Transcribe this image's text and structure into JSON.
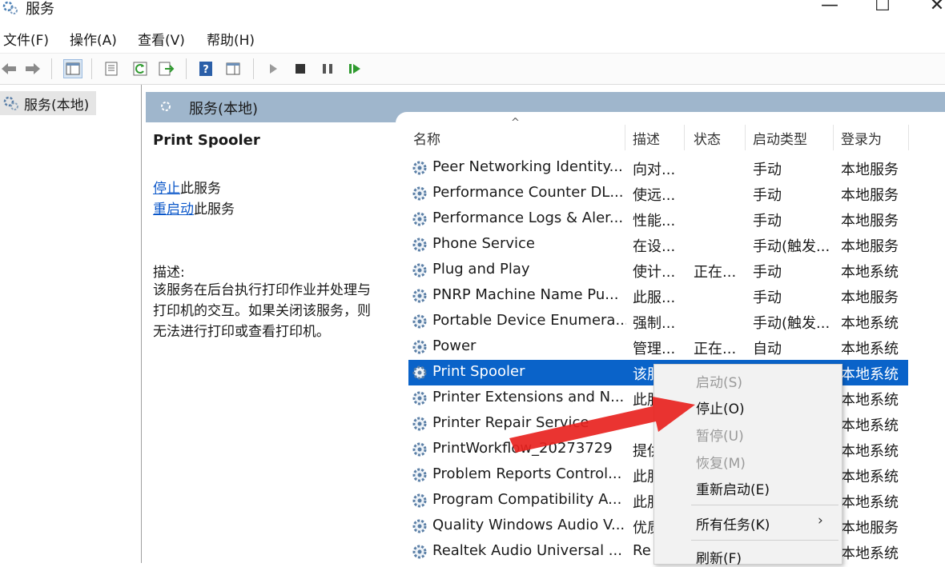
{
  "window": {
    "title": "服务",
    "controls": {
      "minimize": "—",
      "maximize": "☐",
      "close": "✕"
    }
  },
  "menu": [
    "文件(F)",
    "操作(A)",
    "查看(V)",
    "帮助(H)"
  ],
  "toolbar": {
    "icons": [
      "back-icon",
      "forward-icon",
      "console-tree-icon",
      "properties-icon",
      "refresh-icon",
      "export-list-icon",
      "help-icon",
      "show-pane-icon",
      "start-service-icon",
      "stop-service-icon",
      "pause-service-icon",
      "resume-service-icon"
    ]
  },
  "tree": {
    "root_label": "服务(本地)"
  },
  "main_header": {
    "title": "服务(本地)"
  },
  "detail": {
    "title": "Print Spooler",
    "stop_link": "停止",
    "stop_suffix": "此服务",
    "restart_link": "重启动",
    "restart_suffix": "此服务",
    "desc_label": "描述:",
    "desc_lines": [
      "该服务在后台执行打印作业并处理与",
      "打印机的交互。如果关闭该服务，则",
      "无法进行打印或查看打印机。"
    ]
  },
  "columns": {
    "name": "名称",
    "desc": "描述",
    "status": "状态",
    "startup": "启动类型",
    "logon": "登录为"
  },
  "services": [
    {
      "name": "Peer Networking Identity...",
      "desc": "向对...",
      "status": "",
      "startup": "手动",
      "logon": "本地服务"
    },
    {
      "name": "Performance Counter DL...",
      "desc": "使远...",
      "status": "",
      "startup": "手动",
      "logon": "本地服务"
    },
    {
      "name": "Performance Logs & Aler...",
      "desc": "性能...",
      "status": "",
      "startup": "手动",
      "logon": "本地服务"
    },
    {
      "name": "Phone Service",
      "desc": "在设...",
      "status": "",
      "startup": "手动(触发...",
      "logon": "本地服务"
    },
    {
      "name": "Plug and Play",
      "desc": "使计...",
      "status": "正在...",
      "startup": "手动",
      "logon": "本地系统"
    },
    {
      "name": "PNRP Machine Name Pu...",
      "desc": "此服...",
      "status": "",
      "startup": "手动",
      "logon": "本地服务"
    },
    {
      "name": "Portable Device Enumera...",
      "desc": "强制...",
      "status": "",
      "startup": "手动(触发...",
      "logon": "本地系统"
    },
    {
      "name": "Power",
      "desc": "管理...",
      "status": "正在...",
      "startup": "自动",
      "logon": "本地系统"
    },
    {
      "name": "Print Spooler",
      "desc": "该服",
      "status": "",
      "startup": "",
      "logon": "本地系统",
      "selected": true
    },
    {
      "name": "Printer Extensions and N...",
      "desc": "此服",
      "status": "",
      "startup": "",
      "logon": "本地系统"
    },
    {
      "name": "Printer Repair Service",
      "desc": "",
      "status": "",
      "startup": "",
      "logon": "本地系统"
    },
    {
      "name": "PrintWorkflow_20273729",
      "desc": "提供",
      "status": "",
      "startup": "",
      "logon": "本地系统"
    },
    {
      "name": "Problem Reports Control...",
      "desc": "此服",
      "status": "",
      "startup": "",
      "logon": "本地系统"
    },
    {
      "name": "Program Compatibility A...",
      "desc": "此服",
      "status": "",
      "startup": "",
      "logon": "本地系统"
    },
    {
      "name": "Quality Windows Audio V...",
      "desc": "优质",
      "status": "",
      "startup": "",
      "logon": "本地服务"
    },
    {
      "name": "Realtek Audio Universal ...",
      "desc": "Re",
      "status": "",
      "startup": "",
      "logon": "本地系统"
    }
  ],
  "context_menu": {
    "start": "启动(S)",
    "stop": "停止(O)",
    "pause": "暂停(U)",
    "resume": "恢复(M)",
    "restart": "重新启动(E)",
    "all_tasks": "所有任务(K)",
    "all_tasks_arrow": "›",
    "refresh": "刷新(F)"
  },
  "colors": {
    "selection": "#0a63c9",
    "header_bar": "#9fb6cc",
    "link": "#0b57c9",
    "annotation_arrow": "#e8231f"
  }
}
